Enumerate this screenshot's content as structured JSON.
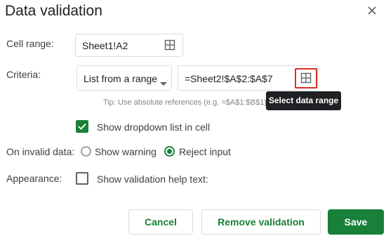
{
  "dialog": {
    "title": "Data validation",
    "close_icon": "close-icon"
  },
  "cell_range": {
    "label": "Cell range:",
    "value": "Sheet1!A2",
    "icon": "grid-select-icon"
  },
  "criteria": {
    "label": "Criteria:",
    "dropdown_value": "List from a range",
    "range_value": "=Sheet2!$A$2:$A$7",
    "icon": "grid-select-icon",
    "tip": "Tip: Use absolute references (e.g. =$A$1:$B$1) to",
    "tooltip": "Select data range"
  },
  "dropdown_option": {
    "label": "Show dropdown list in cell",
    "checked": true
  },
  "invalid_data": {
    "label": "On invalid data:",
    "options": [
      {
        "label": "Show warning",
        "selected": false
      },
      {
        "label": "Reject input",
        "selected": true
      }
    ]
  },
  "appearance": {
    "label": "Appearance:",
    "help_text_label": "Show validation help text:",
    "checked": false
  },
  "buttons": {
    "cancel": "Cancel",
    "remove": "Remove validation",
    "save": "Save"
  },
  "colors": {
    "accent": "#188038",
    "highlight": "#d93025"
  }
}
